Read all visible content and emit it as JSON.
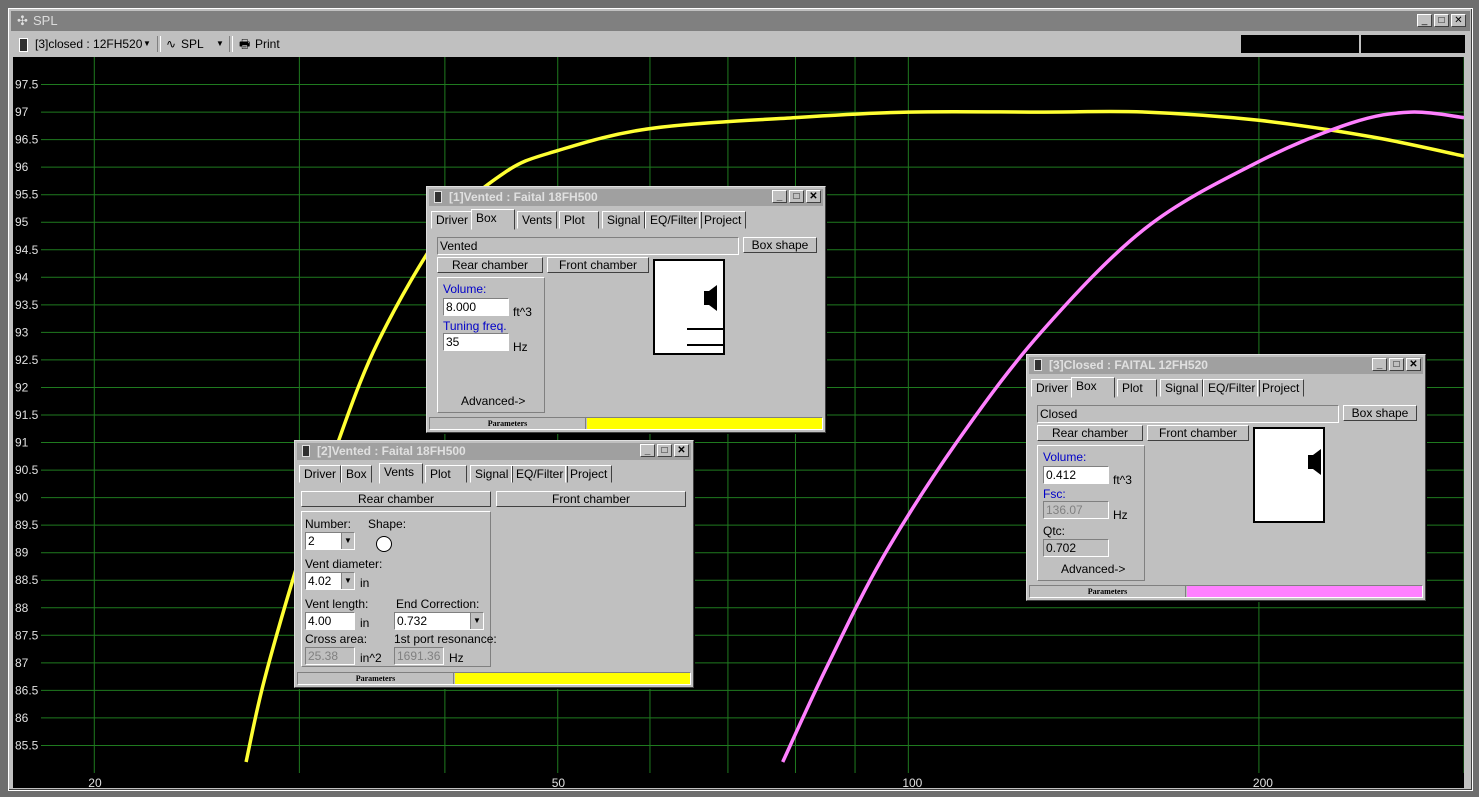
{
  "window": {
    "title": "SPL"
  },
  "toolbar": {
    "project_select": "[3]closed : 12FH520",
    "plot_select": "SPL",
    "print_label": "Print"
  },
  "chart_data": {
    "type": "line",
    "x_scale": "log",
    "xlim": [
      18,
      300
    ],
    "ylim": [
      85,
      98
    ],
    "grid": true,
    "x_ticks": [
      "20",
      "50",
      "100",
      "200"
    ],
    "y_ticks": [
      "85.5",
      "86",
      "86.5",
      "87",
      "87.5",
      "88",
      "88.5",
      "89",
      "89.5",
      "90",
      "90.5",
      "91",
      "91.5",
      "92",
      "92.5",
      "93",
      "93.5",
      "94",
      "94.5",
      "95",
      "95.5",
      "96",
      "96.5",
      "97",
      "97.5"
    ],
    "series": [
      {
        "color": "#ffff33",
        "x": [
          27,
          28,
          30,
          32,
          35,
          40,
          45,
          50,
          60,
          80,
          100,
          130,
          160,
          200,
          250,
          300
        ],
        "y": [
          85.2,
          86.7,
          88.9,
          90.7,
          92.8,
          94.9,
          95.9,
          96.3,
          96.7,
          96.9,
          97.0,
          97.0,
          97.0,
          96.85,
          96.55,
          96.2
        ]
      },
      {
        "color": "#ff80ff",
        "x": [
          78,
          85,
          95,
          110,
          130,
          160,
          200,
          240,
          270,
          300
        ],
        "y": [
          85.2,
          86.9,
          88.9,
          91.0,
          93.0,
          94.9,
          96.1,
          96.8,
          97.0,
          96.9
        ]
      }
    ]
  },
  "win1": {
    "title": "[1]Vented : Faital  18FH500",
    "tabs": [
      "Driver",
      "Box",
      "Vents",
      "Plot",
      "Signal",
      "EQ/Filter",
      "Project"
    ],
    "box_type": "Vented",
    "box_shape_btn": "Box shape",
    "rear_chamber_btn": "Rear chamber",
    "front_chamber_btn": "Front chamber",
    "volume_label": "Volume:",
    "volume_value": "8.000",
    "volume_unit": "ft^3",
    "tuning_label": "Tuning freq.",
    "tuning_value": "35",
    "tuning_unit": "Hz",
    "advanced": "Advanced->",
    "status_label": "Parameters",
    "status_color": "#ffff00"
  },
  "win2": {
    "title": "[2]Vented : Faital  18FH500",
    "tabs": [
      "Driver",
      "Box",
      "Vents",
      "Plot",
      "Signal",
      "EQ/Filter",
      "Project"
    ],
    "rear_chamber_btn": "Rear chamber",
    "front_chamber_btn": "Front chamber",
    "number_label": "Number:",
    "number_value": "2",
    "shape_label": "Shape:",
    "diameter_label": "Vent diameter:",
    "diameter_value": "4.02",
    "diameter_unit": "in",
    "length_label": "Vent length:",
    "length_value": "4.00",
    "length_unit": "in",
    "end_corr_label": "End Correction:",
    "end_corr_value": "0.732",
    "cross_label": "Cross area:",
    "cross_value": "25.38",
    "cross_unit": "in^2",
    "port_res_label": "1st port resonance:",
    "port_res_value": "1691.36",
    "port_res_unit": "Hz",
    "status_label": "Parameters",
    "status_color": "#ffff00"
  },
  "win3": {
    "title": "[3]Closed : FAITAL  12FH520",
    "tabs": [
      "Driver",
      "Box",
      "Plot",
      "Signal",
      "EQ/Filter",
      "Project"
    ],
    "box_type": "Closed",
    "box_shape_btn": "Box shape",
    "rear_chamber_btn": "Rear chamber",
    "front_chamber_btn": "Front chamber",
    "volume_label": "Volume:",
    "volume_value": "0.412",
    "volume_unit": "ft^3",
    "fsc_label": "Fsc:",
    "fsc_value": "136.07",
    "fsc_unit": "Hz",
    "qtc_label": "Qtc:",
    "qtc_value": "0.702",
    "advanced": "Advanced->",
    "status_label": "Parameters",
    "status_color": "#ff80ff"
  }
}
